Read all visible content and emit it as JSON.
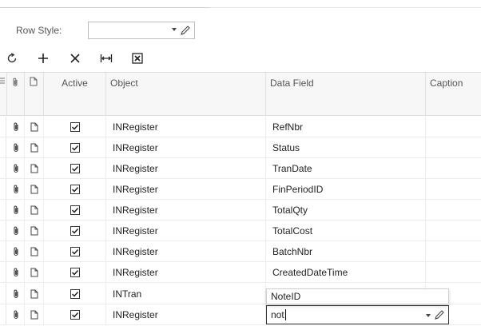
{
  "filter": {
    "row_style_label": "Row Style:",
    "row_style_value": ""
  },
  "toolbar": {
    "buttons": [
      {
        "name": "refresh",
        "icon": "refresh-icon"
      },
      {
        "name": "add",
        "icon": "plus-icon"
      },
      {
        "name": "delete",
        "icon": "x-icon"
      },
      {
        "name": "fit-columns",
        "icon": "fit-width-icon"
      },
      {
        "name": "export",
        "icon": "excel-export-icon"
      }
    ]
  },
  "grid": {
    "columns": {
      "active": "Active",
      "object": "Object",
      "data_field": "Data Field",
      "caption": "Caption"
    },
    "rows": [
      {
        "active": true,
        "object": "INRegister",
        "data_field": "RefNbr",
        "caption": ""
      },
      {
        "active": true,
        "object": "INRegister",
        "data_field": "Status",
        "caption": ""
      },
      {
        "active": true,
        "object": "INRegister",
        "data_field": "TranDate",
        "caption": ""
      },
      {
        "active": true,
        "object": "INRegister",
        "data_field": "FinPeriodID",
        "caption": ""
      },
      {
        "active": true,
        "object": "INRegister",
        "data_field": "TotalQty",
        "caption": ""
      },
      {
        "active": true,
        "object": "INRegister",
        "data_field": "TotalCost",
        "caption": ""
      },
      {
        "active": true,
        "object": "INRegister",
        "data_field": "BatchNbr",
        "caption": ""
      },
      {
        "active": true,
        "object": "INRegister",
        "data_field": "CreatedDateTime",
        "caption": ""
      },
      {
        "active": true,
        "object": "INTran",
        "data_field": "",
        "caption": ""
      },
      {
        "active": true,
        "object": "INRegister",
        "data_field": "not",
        "caption": ""
      }
    ]
  },
  "autocomplete": {
    "suggestion": "NoteID"
  },
  "colors": {
    "header_bg": "#f7f7f7",
    "grid_line": "#ececec",
    "edit_border": "#333333"
  }
}
